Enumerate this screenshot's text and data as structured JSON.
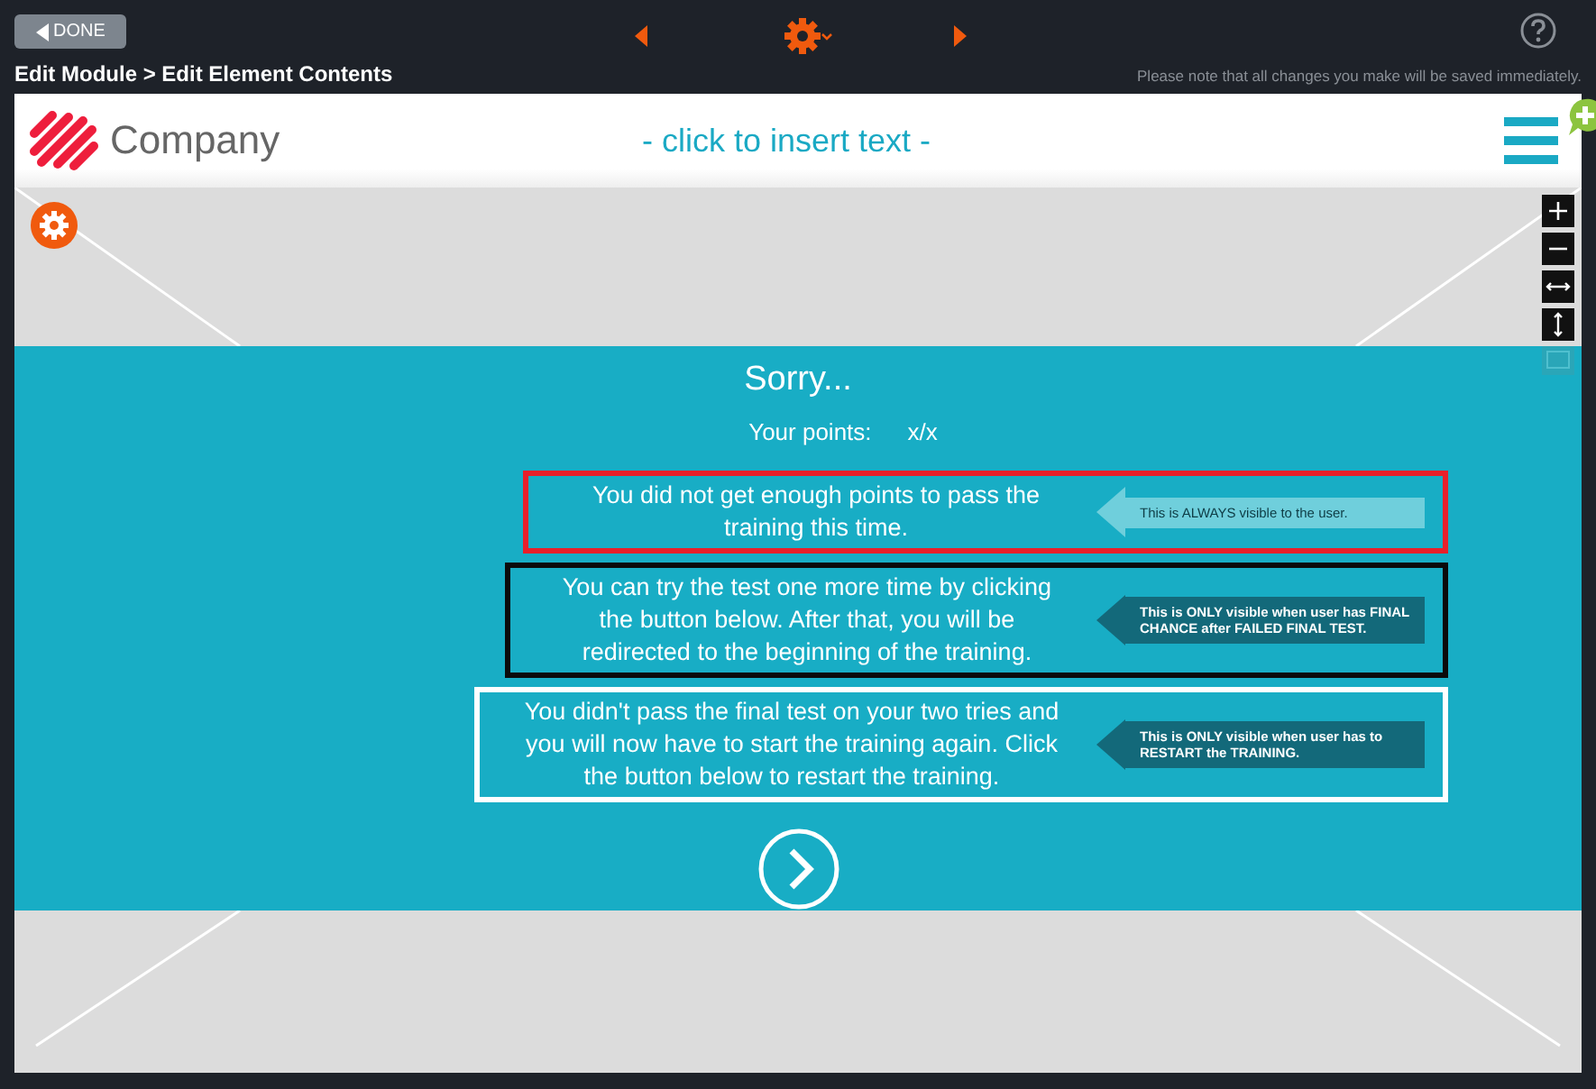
{
  "toolbar": {
    "done_button": "DONE",
    "breadcrumb": "Edit Module > Edit Element Contents",
    "notice": "Please note that all changes you make will be saved immediately."
  },
  "header": {
    "company": "Company",
    "insert_text": "- click to insert text -"
  },
  "result": {
    "title": "Sorry...",
    "points_label": "Your points:",
    "points_value": "x/x"
  },
  "messages": [
    {
      "text": "You did not get enough points to pass the training this time.",
      "color": "#e8202a",
      "kind": "light",
      "note": "This is ALWAYS visible to the user."
    },
    {
      "text": "You can try the test one more time by clicking the button below. After that, you will be redirected to the beginning of the training.",
      "color": "#0b0b0b",
      "kind": "dark",
      "note": "This is ONLY visible when user has FINAL CHANCE after FAILED FINAL TEST."
    },
    {
      "text": "You didn't pass the final test on your two tries and you will now have to start the training again. Click the button below to restart the training.",
      "color": "#ffffff",
      "kind": "dark",
      "note": "This is ONLY visible when user has to RESTART the TRAINING."
    }
  ]
}
